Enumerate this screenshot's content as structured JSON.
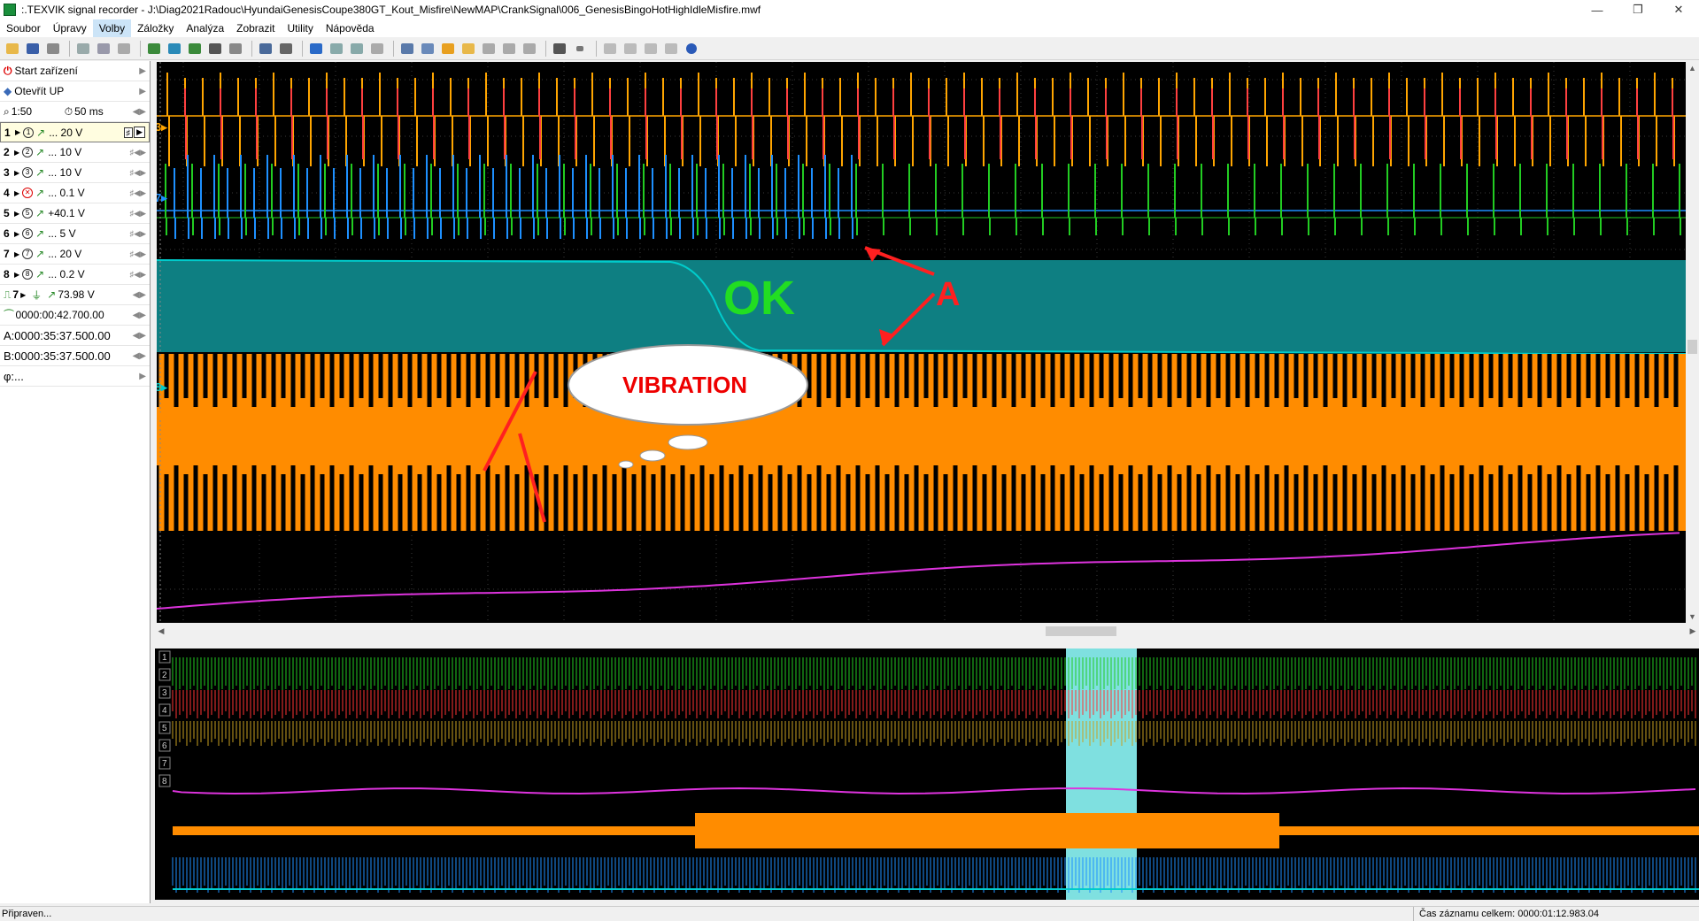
{
  "window": {
    "title": ":.TEXVIK  signal recorder - J:\\Diag2021Radouc\\HyundaiGenesisCoupe380GT_Kout_Misfire\\NewMAP\\CrankSignal\\006_GenesisBingoHotHighIdleMisfire.mwf",
    "min": "—",
    "max": "❐",
    "close": "✕"
  },
  "menu": [
    "Soubor",
    "Úpravy",
    "Volby",
    "Záložky",
    "Analýza",
    "Zobrazit",
    "Utility",
    "Nápověda"
  ],
  "sidebar": {
    "start": "Start zařízení",
    "open": "Otevřít UP",
    "zoom": "1:50",
    "timebase": "50 ms",
    "channels": [
      {
        "n": "1",
        "val": "... 20 V"
      },
      {
        "n": "2",
        "val": "... 10 V"
      },
      {
        "n": "3",
        "val": "... 10 V"
      },
      {
        "n": "4",
        "val": "... 0.1 V"
      },
      {
        "n": "5",
        "val": "+40.1 V"
      },
      {
        "n": "6",
        "val": "... 5 V"
      },
      {
        "n": "7",
        "val": "... 20 V"
      },
      {
        "n": "8",
        "val": "... 0.2 V"
      }
    ],
    "trig_ch": "7",
    "trig_val": "73.98 V",
    "pretrig": "0000:00:42.700.00",
    "cursor_a": "A:0000:35:37.500.00",
    "cursor_b": "B:0000:35:37.500.00",
    "phi": "φ:..."
  },
  "plot_markers": {
    "ch3": "3",
    "ch7": "7",
    "ch8": "8",
    "ch6": "6"
  },
  "overview_labels": [
    "1",
    "2",
    "3",
    "4",
    "5",
    "6",
    "7",
    "8"
  ],
  "annotations": {
    "ok": "OK",
    "a": "A",
    "vibration": "VIBRATION"
  },
  "status": {
    "left": "Připraven...",
    "right": "Čas záznamu celkem: 0000:01:12.983.04"
  },
  "colors": {
    "ch3": "#ffa500",
    "ch7": "#1e90ff",
    "ch8": "#00cccc",
    "ch6": "#ff8c00",
    "ch5": "#dd33dd",
    "ch1": "#22cc22",
    "ch2": "#ff3333"
  }
}
